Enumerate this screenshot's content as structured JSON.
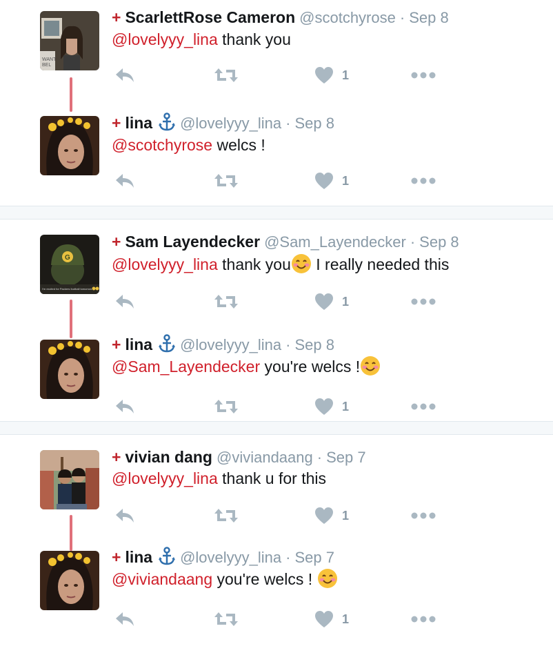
{
  "threads": [
    {
      "tweets": [
        {
          "name": "ScarlettRose Cameron",
          "handle": "@scotchyrose",
          "separator": "·",
          "time": "Sep 8",
          "text_mention": "@lovelyyy_lina",
          "text_body": " thank you",
          "emoji": "",
          "like_count": "1",
          "avatar": "scarlett-avatar",
          "has_anchor": false
        },
        {
          "name": "lina",
          "handle": "@lovelyyy_lina",
          "separator": "·",
          "time": "Sep 8",
          "text_mention": "@scotchyrose",
          "text_body": " welcs !",
          "emoji": "",
          "like_count": "1",
          "avatar": "lina-avatar",
          "has_anchor": true
        }
      ]
    },
    {
      "tweets": [
        {
          "name": "Sam Layendecker",
          "handle": "@Sam_Layendecker",
          "separator": "·",
          "time": "Sep 8",
          "text_mention": "@lovelyyy_lina",
          "text_body": " thank you",
          "emoji": "smiling-face-emoji",
          "text_after": " I really needed this",
          "like_count": "1",
          "avatar": "sam-avatar",
          "has_anchor": false
        },
        {
          "name": "lina",
          "handle": "@lovelyyy_lina",
          "separator": "·",
          "time": "Sep 8",
          "text_mention": "@Sam_Layendecker",
          "text_body": " you're welcs !",
          "emoji": "smiling-face-emoji",
          "text_after": "",
          "like_count": "1",
          "avatar": "lina-avatar",
          "has_anchor": true
        }
      ]
    },
    {
      "tweets": [
        {
          "name": "vivian dang",
          "handle": "@viviandaang",
          "separator": "·",
          "time": "Sep 7",
          "text_mention": "@lovelyyy_lina",
          "text_body": " thank u for this",
          "emoji": "",
          "like_count": "1",
          "avatar": "vivian-avatar",
          "has_anchor": false
        },
        {
          "name": "lina",
          "handle": "@lovelyyy_lina",
          "separator": "·",
          "time": "Sep 7",
          "text_mention": "@viviandaang",
          "text_body": " you're welcs ! ",
          "emoji": "smiling-face-emoji",
          "text_after": "",
          "like_count": "1",
          "avatar": "lina-avatar",
          "has_anchor": true
        }
      ]
    }
  ],
  "colors": {
    "mention": "#d0202b",
    "plus": "#c0262d",
    "thread_line": "#e0707a",
    "icon": "#aab8c2",
    "meta": "#8899a6",
    "anchor": "#2f6fad",
    "separator_bg": "#f5f8fa"
  },
  "icons": [
    "reply-icon",
    "retweet-icon",
    "heart-icon",
    "more-icon",
    "anchor-icon"
  ]
}
